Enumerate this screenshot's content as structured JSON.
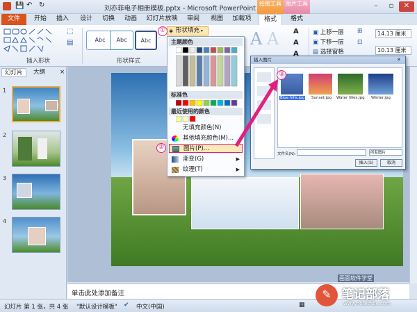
{
  "titlebar": {
    "title": "刘亦菲电子相册模板.pptx - Microsoft PowerPoint",
    "context_draw": "绘图工具",
    "context_picture": "图片工具",
    "min": "–",
    "max": "▫",
    "close": "✕"
  },
  "tabs": [
    "文件",
    "开始",
    "插入",
    "设计",
    "切换",
    "动画",
    "幻灯片放映",
    "审阅",
    "视图",
    "加载项",
    "格式",
    "格式"
  ],
  "ribbon": {
    "group_insert_shapes": "插入形状",
    "group_shape_styles": "形状样式",
    "style_label": "Abc",
    "shape_fill_button": "形状填充",
    "arrange": [
      "上移一层",
      "下移一层",
      "选择窗格"
    ],
    "size_height": "14.13 厘米",
    "size_width": "10.13 厘米",
    "big_letter": "A"
  },
  "fill_menu": {
    "theme_colors": "主题颜色",
    "standard_colors": "标准色",
    "recent_colors": "最近使用的颜色",
    "no_fill": "无填充颜色(N)",
    "more_colors": "其他填充颜色(M)...",
    "picture": "图片(P)...",
    "gradient": "渐变(G)",
    "texture": "纹理(T)"
  },
  "dialog": {
    "title": "插入图片",
    "files": [
      "Blue hills.jpg",
      "Sunset.jpg",
      "Water lilies.jpg",
      "Winter.jpg"
    ],
    "filename_label": "文件名(N):",
    "filetype_label": "所有图片",
    "insert_btn": "插入(S)",
    "cancel_btn": "取消"
  },
  "callouts": [
    "①",
    "②",
    "③"
  ],
  "slide_panel": {
    "tab_slides": "幻灯片",
    "tab_outline": "大纲",
    "close": "×",
    "numbers": [
      "1",
      "2",
      "3",
      "4"
    ]
  },
  "notes": "单击此处添加备注",
  "status": {
    "slide_info": "幻灯片 第 1 张，共 4 张",
    "theme": "\"默认设计模板\"",
    "language": "中文(中国)"
  },
  "watermark": {
    "name": "笔记部落",
    "url": "www.notetribe.com",
    "top_text": "画面软件学堂"
  },
  "colors": {
    "accent_magenta": "#e1207e",
    "file_tab": "#d9531e"
  }
}
